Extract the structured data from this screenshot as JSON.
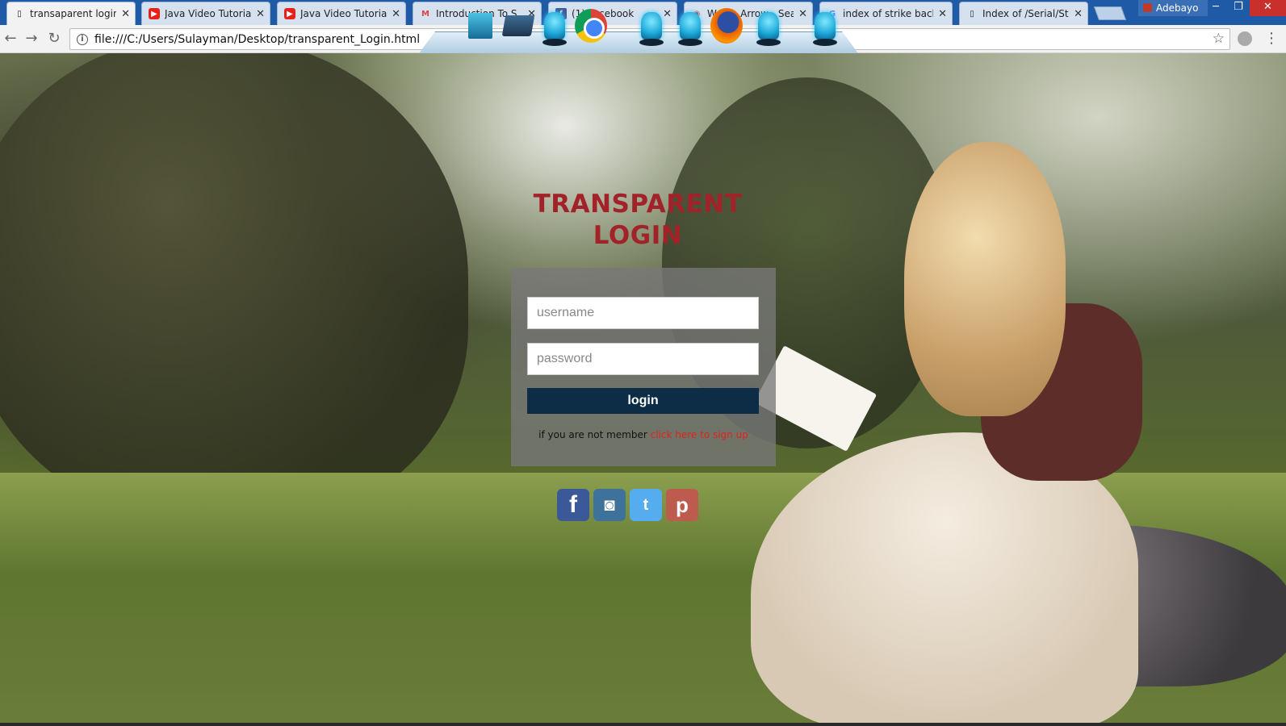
{
  "browser": {
    "tabs": [
      {
        "title": "transaparent login fo",
        "icon": "page-icon",
        "active": true
      },
      {
        "title": "Java Video Tutorial",
        "icon": "youtube-icon",
        "active": false
      },
      {
        "title": "Java Video Tutorial",
        "icon": "youtube-icon",
        "active": false
      },
      {
        "title": "Introduction To S",
        "icon": "gmail-icon",
        "active": false
      },
      {
        "title": "(1) Facebook",
        "icon": "facebook-icon",
        "active": false
      },
      {
        "title": "Watch Arrow - Seas",
        "icon": "watch-icon",
        "active": false
      },
      {
        "title": "index of strike back",
        "icon": "google-icon",
        "active": false
      },
      {
        "title": "Index of /Serial/Strik",
        "icon": "page-icon",
        "active": false
      }
    ],
    "profile_name": "Adebayo",
    "url": "file:///C:/Users/Sulayman/Desktop/transparent_Login.html"
  },
  "login": {
    "title_line1": "TRANSPARENT",
    "title_line2": "LOGIN",
    "username_placeholder": "username",
    "password_placeholder": "password",
    "button_label": "login",
    "signup_prefix": "if you are not member",
    "signup_link": "click here to sign up"
  },
  "social": {
    "facebook": "f",
    "instagram": "◙",
    "twitter": "t",
    "pinterest": "p"
  },
  "colors": {
    "title": "#a2222a",
    "button": "#0d2d47",
    "signup_link": "#e3201c"
  }
}
